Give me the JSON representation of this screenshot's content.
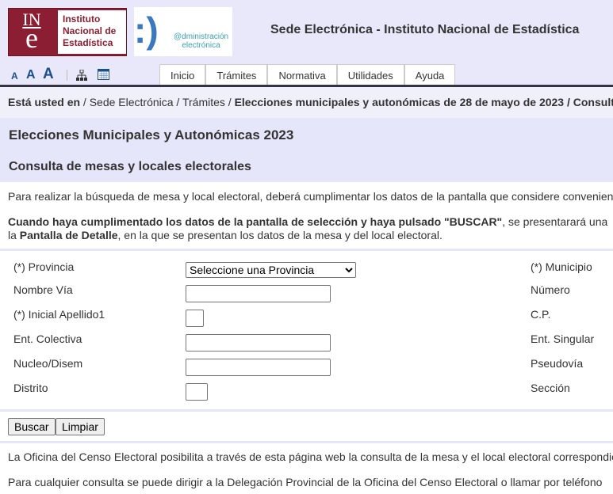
{
  "header": {
    "logo_ine": {
      "mark_top": "IN",
      "mark_bottom": "e",
      "text": "Instituto Nacional de Estadística"
    },
    "logo_ae": {
      "text_line1": "@dministración",
      "text_line2": "electrónica"
    },
    "title": "Sede Electrónica - Instituto Nacional de Estadística"
  },
  "toolbar": {
    "font_sizes": [
      "A",
      "A",
      "A"
    ],
    "icons": [
      "sitemap-icon",
      "calendar-icon"
    ]
  },
  "tabs": [
    {
      "label": "Inicio"
    },
    {
      "label": "Trámites"
    },
    {
      "label": "Normativa"
    },
    {
      "label": "Utilidades"
    },
    {
      "label": "Ayuda"
    }
  ],
  "breadcrumb": {
    "prefix": "Está usted en",
    "items": [
      "Sede Electrónica",
      "Trámites"
    ],
    "current": "Elecciones municipales y autonómicas de 28 de mayo de 2023 / Consulta de mesas y locales electorales"
  },
  "page": {
    "title": "Elecciones Municipales y Autonómicas 2023",
    "subtitle": "Consulta de mesas y locales electorales",
    "intro": "Para realizar la búsqueda de mesa y local electoral, deberá cumplimentar los datos de la pantalla que considere convenientes",
    "info_bold1": "Cuando haya cumplimentado los datos de la pantalla de selección y haya pulsado \"BUSCAR\"",
    "info_mid": ", se presentarará una ",
    "info_line2_prefix": "la ",
    "info_bold2": "Pantalla de Detalle",
    "info_end": ", en la que se presentan los datos de la mesa y del local electoral."
  },
  "form": {
    "left": [
      {
        "label": "(*) Provincia"
      },
      {
        "label": "Nombre Vía"
      },
      {
        "label": "(*) Inicial Apellido1"
      },
      {
        "label": "Ent. Colectiva"
      },
      {
        "label": "Nucleo/Disem"
      },
      {
        "label": "Distrito"
      }
    ],
    "right": [
      {
        "label": "(*) Municipio"
      },
      {
        "label": "Número"
      },
      {
        "label": "C.P."
      },
      {
        "label": "Ent. Singular"
      },
      {
        "label": "Pseudovía"
      },
      {
        "label": "Sección"
      }
    ],
    "provincia_selected": "Seleccione una Provincia",
    "buscar": "Buscar",
    "limpiar": "Limpiar"
  },
  "footer": {
    "p1": "La Oficina del Censo Electoral posibilita a través de esta página web la consulta de la mesa y el local electoral correspondiente",
    "p2": "Para cualquier consulta se puede dirigir a la Delegación Provincial de la Oficina del Censo Electoral o llamar por teléfono"
  },
  "colors": {
    "ine_red": "#8b1e32",
    "lavender": "#e6e6fa",
    "link_blue": "#1a4f8b"
  }
}
